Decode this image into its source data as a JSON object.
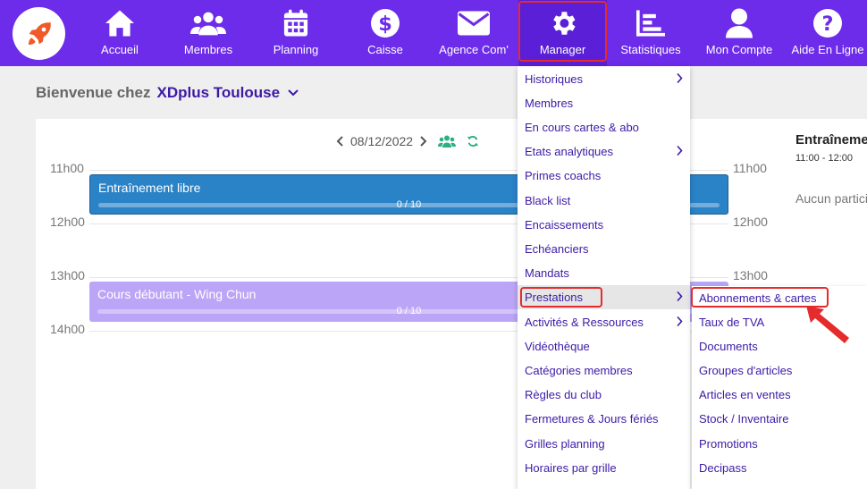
{
  "nav": {
    "items": [
      {
        "label": "Accueil",
        "icon": "home-icon"
      },
      {
        "label": "Membres",
        "icon": "members-icon"
      },
      {
        "label": "Planning",
        "icon": "calendar-icon"
      },
      {
        "label": "Caisse",
        "icon": "dollar-icon"
      },
      {
        "label": "Agence Com'",
        "icon": "mail-icon"
      },
      {
        "label": "Manager",
        "icon": "gear-icon"
      },
      {
        "label": "Statistiques",
        "icon": "chart-icon"
      },
      {
        "label": "Mon Compte",
        "icon": "user-icon"
      },
      {
        "label": "Aide En Ligne",
        "icon": "help-icon"
      }
    ],
    "active": "Manager"
  },
  "welcome": {
    "prefix": "Bienvenue chez",
    "club": "XDplus Toulouse"
  },
  "calendar": {
    "date": "08/12/2022",
    "times": [
      "11h00",
      "12h00",
      "13h00",
      "14h00"
    ],
    "events": [
      {
        "title": "Entraînement libre",
        "count": "0 / 10",
        "color": "#2a82c7"
      },
      {
        "title": "Cours débutant - Wing Chun",
        "count": "0 / 10",
        "color": "#bba5f6"
      }
    ]
  },
  "side": {
    "title": "Entraînement",
    "time": "11:00 - 12:00",
    "none": "Aucun participant"
  },
  "menu": {
    "items": [
      {
        "label": "Historiques",
        "has_sub": true
      },
      {
        "label": "Membres",
        "has_sub": false
      },
      {
        "label": "En cours cartes & abo",
        "has_sub": false
      },
      {
        "label": "Etats analytiques",
        "has_sub": true
      },
      {
        "label": "Primes coachs",
        "has_sub": false
      },
      {
        "label": "Black list",
        "has_sub": false
      },
      {
        "label": "Encaissements",
        "has_sub": false
      },
      {
        "label": "Echéanciers",
        "has_sub": false
      },
      {
        "label": "Mandats",
        "has_sub": false
      },
      {
        "label": "Prestations",
        "has_sub": true
      },
      {
        "label": "Activités & Ressources",
        "has_sub": true
      },
      {
        "label": "Vidéothèque",
        "has_sub": false
      },
      {
        "label": "Catégories membres",
        "has_sub": false
      },
      {
        "label": "Règles du club",
        "has_sub": false
      },
      {
        "label": "Fermetures & Jours fériés",
        "has_sub": false
      },
      {
        "label": "Grilles planning",
        "has_sub": false
      },
      {
        "label": "Horaires par grille",
        "has_sub": false
      }
    ],
    "hovered": "Prestations"
  },
  "submenu": {
    "items": [
      "Abonnements & cartes",
      "Taux de TVA",
      "Documents",
      "Groupes d'articles",
      "Articles en ventes",
      "Stock / Inventaire",
      "Promotions",
      "Decipass"
    ]
  },
  "colors": {
    "nav_bg": "#6d2bea",
    "menu_text": "#3d1aa6",
    "highlight": "#e52b2b",
    "logo_rocket": "#f05a28"
  }
}
